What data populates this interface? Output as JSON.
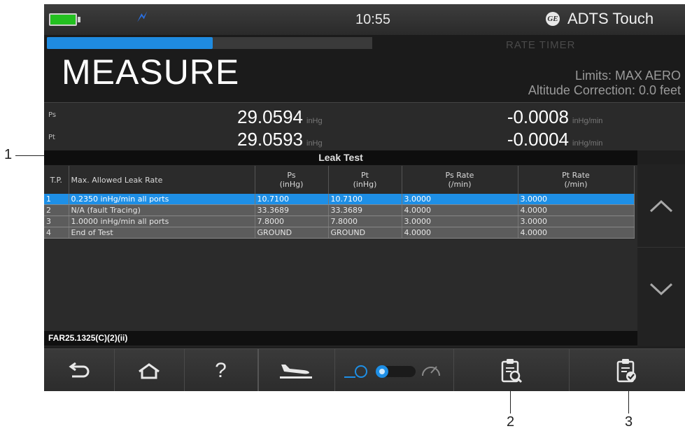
{
  "callouts": {
    "one": "1",
    "two": "2",
    "three": "3"
  },
  "status_bar": {
    "time": "10:55",
    "app_title": "ADTS Touch",
    "logo_text": "GE"
  },
  "header": {
    "progress_percent": 51,
    "rate_timer_label": "RATE TIMER",
    "mode_title": "MEASURE",
    "limits": "Limits: MAX AERO",
    "altitude_correction": "Altitude Correction: 0.0 feet"
  },
  "measurements": {
    "ps": {
      "label": "Ps",
      "value": "29.0594",
      "unit": "inHg",
      "rate": "-0.0008",
      "rate_unit": "inHg/min"
    },
    "pt": {
      "label": "Pt",
      "value": "29.0593",
      "unit": "inHg",
      "rate": "-0.0004",
      "rate_unit": "inHg/min"
    }
  },
  "leak_test": {
    "title": "Leak Test",
    "columns": {
      "tp": "T.P.",
      "max_rate": "Max. Allowed Leak Rate",
      "ps": "Ps",
      "ps_unit": "(inHg)",
      "pt": "Pt",
      "pt_unit": "(inHg)",
      "ps_rate": "Ps Rate",
      "ps_rate_unit": "(/min)",
      "pt_rate": "Pt Rate",
      "pt_rate_unit": "(/min)"
    },
    "rows": [
      {
        "tp": "1",
        "max_rate": "0.2350 inHg/min all ports",
        "ps": "10.7100",
        "pt": "10.7100",
        "ps_rate": "3.0000",
        "pt_rate": "3.0000"
      },
      {
        "tp": "2",
        "max_rate": "N/A  (fault Tracing)",
        "ps": "33.3689",
        "pt": "33.3689",
        "ps_rate": "4.0000",
        "pt_rate": "4.0000"
      },
      {
        "tp": "3",
        "max_rate": "1.0000 inHg/min all ports",
        "ps": "7.8000",
        "pt": "7.8000",
        "ps_rate": "3.0000",
        "pt_rate": "3.0000"
      },
      {
        "tp": "4",
        "max_rate": "End of Test",
        "ps": "GROUND",
        "pt": "GROUND",
        "ps_rate": "4.0000",
        "pt_rate": "4.0000"
      }
    ],
    "standard": "FAR25.1325(C)(2)(ii)"
  },
  "colors": {
    "accent_blue": "#1e8fe6",
    "battery_green": "#23c020",
    "antenna_blue": "#2a6fe0"
  },
  "icons": [
    "battery-icon",
    "antenna-icon",
    "ge-logo-icon",
    "chevron-up-icon",
    "chevron-down-icon",
    "back-icon",
    "home-icon",
    "help-icon",
    "aircraft-landing-icon",
    "leak-measure-toggle-icon",
    "clipboard-search-icon",
    "clipboard-check-icon"
  ]
}
